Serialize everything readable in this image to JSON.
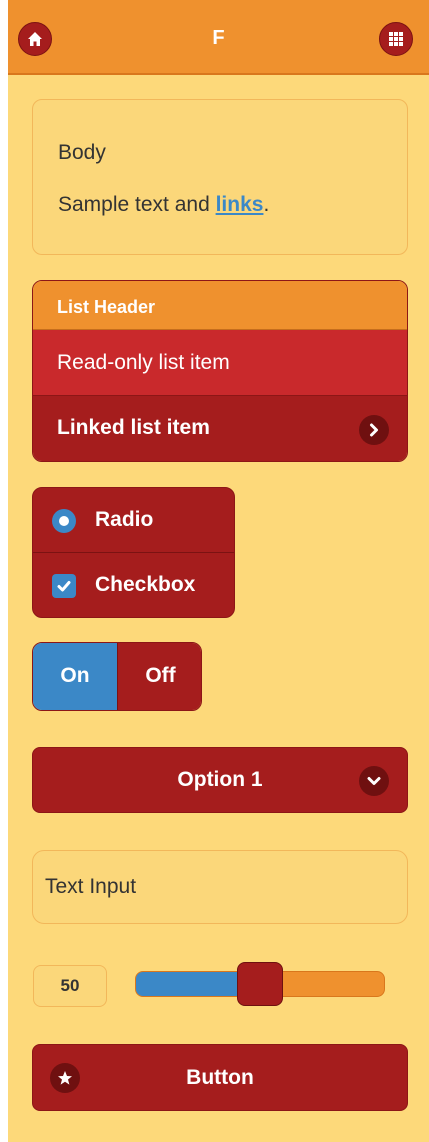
{
  "header": {
    "title": "F",
    "left_icon": "home-icon",
    "right_icon": "grid-icon"
  },
  "body_panel": {
    "heading": "Body",
    "text_before_link": "Sample text and ",
    "link_text": "links",
    "text_after_link": "."
  },
  "list": {
    "header": "List Header",
    "readonly_item": "Read-only list item",
    "linked_item": "Linked list item",
    "linked_icon": "chevron-right-icon"
  },
  "controlgroup": {
    "radio_label": "Radio",
    "checkbox_label": "Checkbox"
  },
  "flipswitch": {
    "on_label": "On",
    "off_label": "Off",
    "state": "on"
  },
  "select": {
    "selected": "Option 1",
    "icon": "chevron-down-icon"
  },
  "text_input": {
    "placeholder": "Text Input"
  },
  "slider": {
    "value": "50",
    "min": 0,
    "max": 100
  },
  "button": {
    "label": "Button",
    "icon": "star-icon"
  },
  "colors": {
    "header": "#ef912e",
    "body_bg": "#fdd97a",
    "dark_red": "#a51d1d",
    "red": "#c9292c",
    "blue": "#3b88c7"
  }
}
